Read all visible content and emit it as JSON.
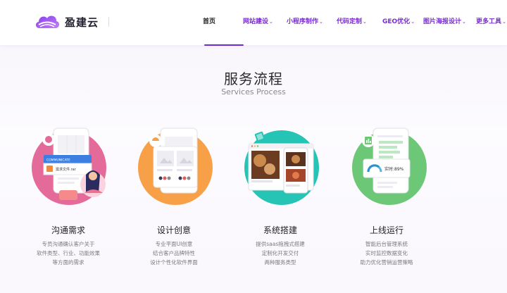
{
  "header": {
    "logo_text": "盈建云",
    "nav": [
      {
        "label": "首页",
        "dropdown": false,
        "active": true
      },
      {
        "label": "网站建设",
        "dropdown": true
      },
      {
        "label": "小程序制作",
        "dropdown": true
      },
      {
        "label": "代码定制",
        "dropdown": true
      },
      {
        "label": "GEO优化",
        "dropdown": true
      },
      {
        "label": "图片海报设计",
        "dropdown": true
      },
      {
        "label": "更多工具",
        "dropdown": true
      }
    ]
  },
  "section": {
    "title": "服务流程",
    "subtitle": "Services Process"
  },
  "steps": [
    {
      "title": "沟通需求",
      "desc": [
        "专员沟通确认客户关于",
        "软件类型、行业、功能效果",
        "等方面的需求"
      ],
      "circle_color": "#e46a99",
      "card_header": "COMMUNICATE",
      "file_label": "需求文件.rar"
    },
    {
      "title": "设计创意",
      "desc": [
        "专业平面UI创意",
        "结合客户品牌特性",
        "设计个性化软件界面"
      ],
      "circle_color": "#f7a047"
    },
    {
      "title": "系统搭建",
      "desc": [
        "提供saas拖拽式搭建",
        "定制化开发交付",
        "两种服务类型"
      ],
      "circle_color": "#25c4b5"
    },
    {
      "title": "上线运行",
      "desc": [
        "智能后台管理系统",
        "实时监控数据变化",
        "助力优化营销运营策略"
      ],
      "circle_color": "#6cc777",
      "gauge_label": "实时:89%"
    }
  ],
  "colors": {
    "accent": "#6e2bd0",
    "nav_text": "#7a2ccf"
  }
}
